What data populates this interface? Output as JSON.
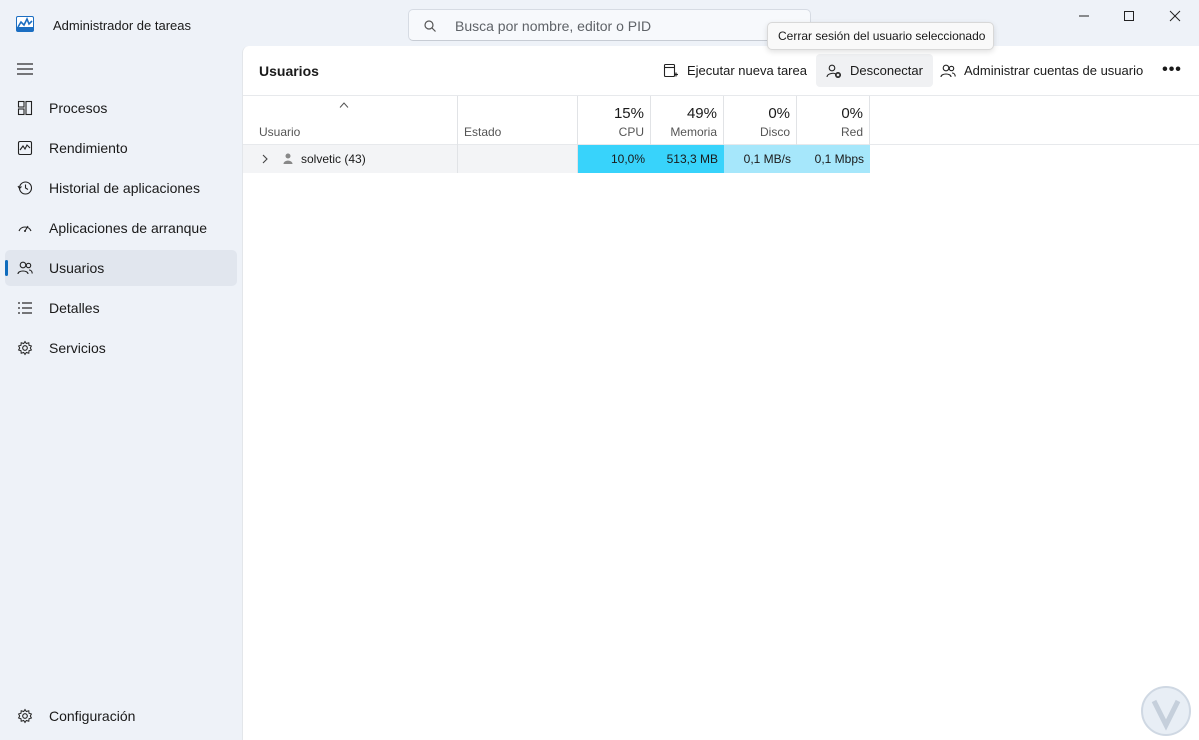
{
  "app": {
    "title": "Administrador de tareas"
  },
  "search": {
    "placeholder": "Busca por nombre, editor o PID"
  },
  "nav": {
    "items": [
      {
        "label": "Procesos",
        "icon": "processes-grid-icon"
      },
      {
        "label": "Rendimiento",
        "icon": "performance-chart-icon"
      },
      {
        "label": "Historial de aplicaciones",
        "icon": "history-icon"
      },
      {
        "label": "Aplicaciones de arranque",
        "icon": "startup-gauge-icon"
      },
      {
        "label": "Usuarios",
        "icon": "users-icon",
        "active": true
      },
      {
        "label": "Detalles",
        "icon": "details-list-icon"
      },
      {
        "label": "Servicios",
        "icon": "services-gear-icon"
      }
    ],
    "settings_label": "Configuración"
  },
  "page": {
    "title": "Usuarios",
    "toolbar": {
      "run_task": "Ejecutar nueva tarea",
      "disconnect": "Desconectar",
      "manage_accounts": "Administrar cuentas de usuario",
      "more": "•••"
    },
    "tooltip": "Cerrar sesión del usuario seleccionado"
  },
  "table": {
    "columns": {
      "user": "Usuario",
      "status": "Estado",
      "cpu": {
        "label": "CPU",
        "pct": "15%"
      },
      "memory": {
        "label": "Memoria",
        "pct": "49%"
      },
      "disk": {
        "label": "Disco",
        "pct": "0%"
      },
      "network": {
        "label": "Red",
        "pct": "0%"
      }
    },
    "rows": [
      {
        "user": "solvetic (43)",
        "status": "",
        "cpu": "10,0%",
        "memory": "513,3 MB",
        "disk": "0,1 MB/s",
        "network": "0,1 Mbps"
      }
    ]
  },
  "colors": {
    "accent": "#0f6cbd",
    "cpu_fill": "#38d3fb",
    "memory_fill": "#38d3fb",
    "disk_fill": "#a6e7fb",
    "network_fill": "#a6e7fb"
  }
}
